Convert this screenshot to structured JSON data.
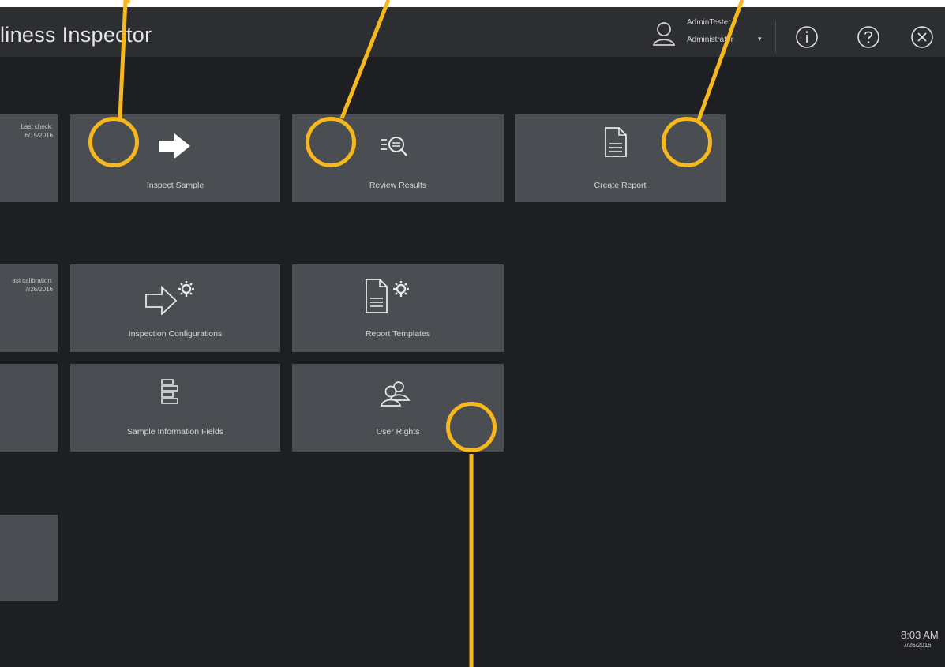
{
  "app": {
    "title": "liness Inspector"
  },
  "user": {
    "name": "AdminTester",
    "role": "Administrator"
  },
  "titlebar_buttons": {
    "info_glyph": "i",
    "help_glyph": "?",
    "close_glyph": "x"
  },
  "left_tiles": {
    "check_note_line1": "Last check:",
    "check_note_line2": "6/15/2016",
    "calibration_note_line1": "ast calibration:",
    "calibration_note_line2": "7/26/2016"
  },
  "tiles": {
    "inspect_sample": "Inspect Sample",
    "review_results": "Review Results",
    "create_report": "Create Report",
    "inspection_configurations": "Inspection Configurations",
    "report_templates": "Report Templates",
    "sample_information_fields": "Sample Information Fields",
    "user_rights": "User Rights"
  },
  "clock": {
    "time": "8:03 AM",
    "date": "7/26/2016"
  },
  "colors": {
    "accent_marker": "#f6b81c",
    "tile": "#4a4d51",
    "background": "#1e1f22",
    "titlebar": "#2c2e31"
  },
  "icons": [
    "user-icon",
    "info-icon",
    "help-icon",
    "close-icon",
    "arrow-right-icon",
    "magnify-list-icon",
    "document-icon",
    "arrow-gear-icon",
    "document-gear-icon",
    "list-fields-icon",
    "users-icon"
  ]
}
